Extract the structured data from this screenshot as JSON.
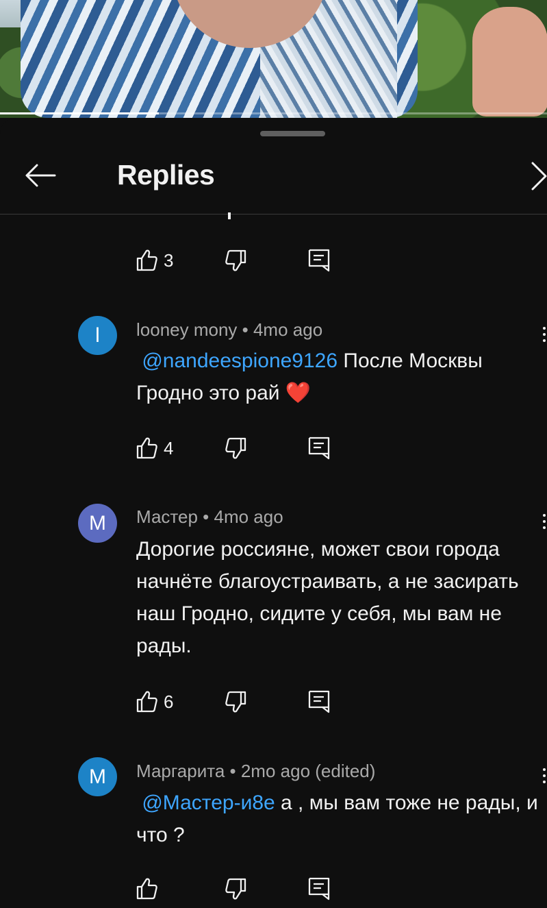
{
  "sheet": {
    "title": "Replies"
  },
  "comments": [
    {
      "likes": "3"
    },
    {
      "avatar_letter": "l",
      "avatar_color": "#1d83c7",
      "author": "looney mony",
      "meta": "looney mony • 4mo ago",
      "mention": "@nandeespione9126",
      "text_after_mention": " После Москвы Гродно это рай ❤️",
      "likes": "4"
    },
    {
      "avatar_letter": "M",
      "avatar_color": "#5c6bc0",
      "meta": "Мастер • 4mo ago",
      "text": "Дорогие россияне, может свои города начнёте благоустраивать, а не засирать наш Гродно, сидите у себя, мы вам не рады.",
      "likes": "6"
    },
    {
      "avatar_letter": "M",
      "avatar_color": "#1d83c7",
      "meta": "Маргарита • 2mo ago (edited)",
      "mention": "@Мастер-и8е",
      "text_after_mention": " а , мы вам тоже не рады, и что ?",
      "likes": ""
    }
  ],
  "icons": {
    "back": "arrow-left-icon",
    "next": "chevron-right-icon",
    "like": "thumb-up-icon",
    "dislike": "thumb-down-icon",
    "reply": "reply-icon",
    "more": "more-vert-icon"
  },
  "colors": {
    "background": "#0f0f0f",
    "text": "#f1f1f1",
    "meta": "#aaaaaa",
    "mention": "#3ea6ff"
  },
  "video": {
    "progress_fraction": 0.29
  }
}
